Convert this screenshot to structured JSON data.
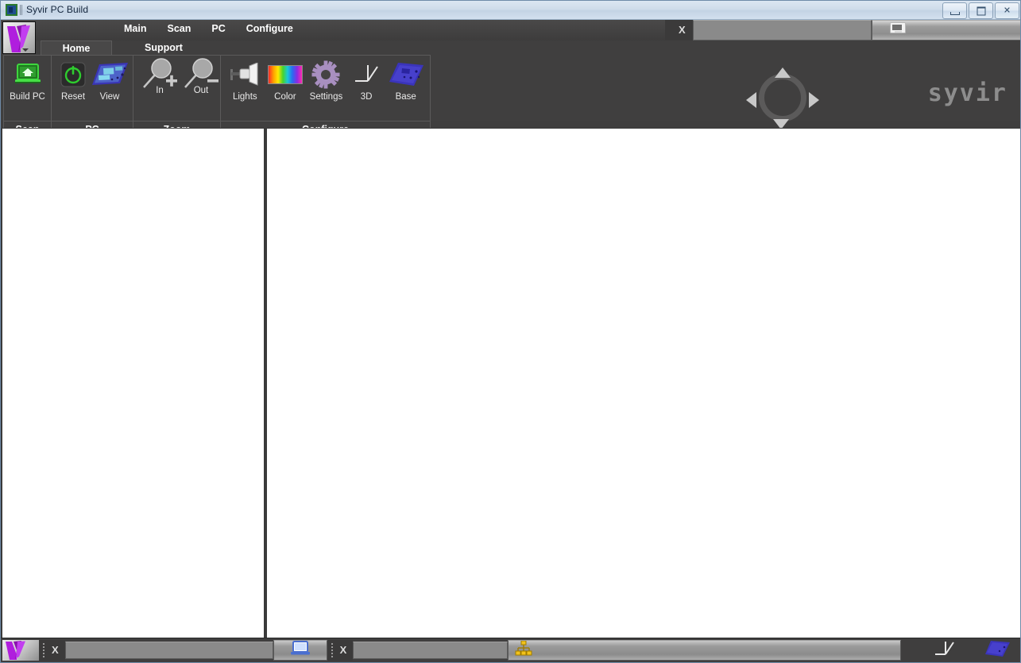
{
  "window": {
    "title": "Syvir PC Build",
    "icon": "app-icon",
    "controls": [
      {
        "name": "minimize-button",
        "label": "–"
      },
      {
        "name": "maximize-button",
        "label": "□"
      },
      {
        "name": "close-button",
        "label": "✕"
      }
    ]
  },
  "app_button": {
    "name": "app-menu-button",
    "icon": "syvir-check-logo"
  },
  "menu": {
    "items": [
      {
        "label": "Main"
      },
      {
        "label": "Scan"
      },
      {
        "label": "PC"
      },
      {
        "label": "Configure"
      }
    ]
  },
  "tabs": [
    {
      "label": "Home",
      "active": true
    },
    {
      "label": "Support",
      "active": false
    }
  ],
  "ribbon": {
    "groups": [
      {
        "label": "Scan",
        "items": [
          {
            "label": "Build PC",
            "icon": "laptop-home-icon"
          }
        ]
      },
      {
        "label": "PC",
        "items": [
          {
            "label": "Reset",
            "icon": "power-button-icon"
          },
          {
            "label": "View",
            "icon": "motherboard-icon"
          }
        ]
      },
      {
        "label": "Zoom",
        "items": [
          {
            "label": "In",
            "icon": "magnifier-plus-icon"
          },
          {
            "label": "Out",
            "icon": "magnifier-minus-icon"
          }
        ]
      },
      {
        "label": "Configure",
        "items": [
          {
            "label": "Lights",
            "icon": "spotlight-icon"
          },
          {
            "label": "Color",
            "icon": "color-spectrum-icon"
          },
          {
            "label": "Settings",
            "icon": "gear-icon"
          },
          {
            "label": "3D",
            "icon": "axis-3d-icon"
          },
          {
            "label": "Base",
            "icon": "motherboard-base-icon"
          }
        ]
      }
    ]
  },
  "nav_pad": {
    "name": "navigation-pad",
    "up": "▲",
    "down": "▼",
    "left": "◀",
    "right": "▶"
  },
  "brand": {
    "text": "syvir"
  },
  "top_toolbar": {
    "close_label": "X",
    "monitor_icon": "monitor-icon"
  },
  "bottom_toolbar": {
    "close_label_1": "X",
    "close_label_2": "X",
    "laptop_icon": "laptop-icon",
    "hierarchy_icon": "hierarchy-icon",
    "axis_icon": "axis-3d-icon",
    "board_icon": "motherboard-icon"
  },
  "colors": {
    "ribbon_bg": "#403f3f",
    "content_bg": "#3a3a3a",
    "pane_bg": "#ffffff",
    "accent_purple": "#b01ede",
    "accent_green": "#34c724",
    "titlebar": "#cfdcea",
    "divider": "#3a3a3a"
  },
  "panes": {
    "left": {
      "name": "left-content-pane",
      "content": ""
    },
    "right": {
      "name": "right-content-pane",
      "content": ""
    }
  }
}
